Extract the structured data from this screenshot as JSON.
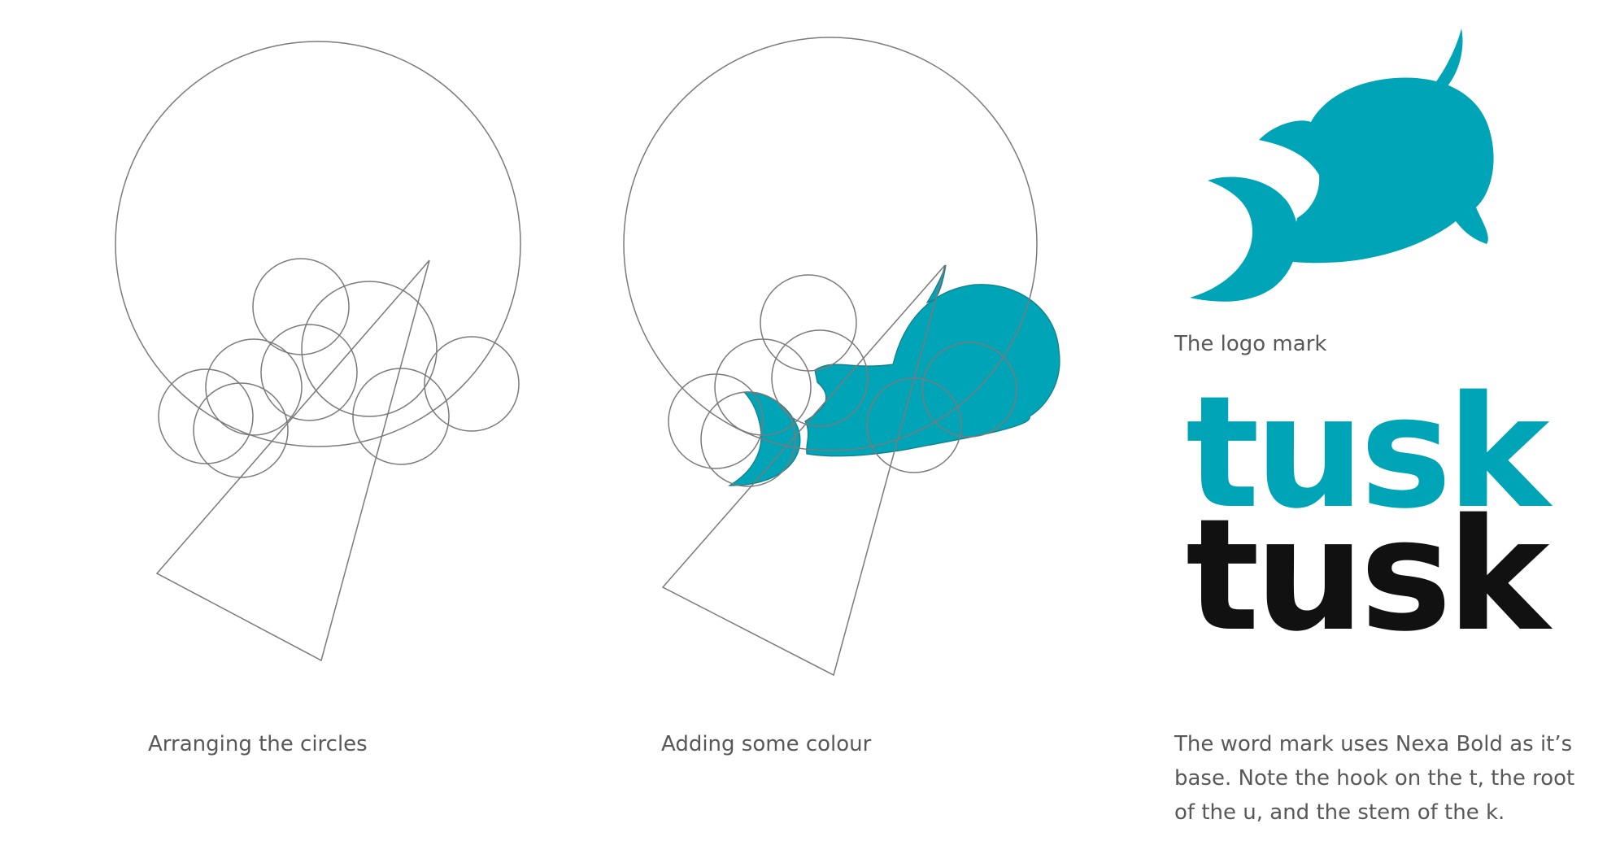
{
  "captions": {
    "construction": "Arranging the circles",
    "colour": "Adding some colour",
    "logo_mark": "The logo mark",
    "word_mark": "The word mark uses Nexa Bold as it’s base. Note the hook on the t, the root of the u, and the stem of the k."
  },
  "wordmark": {
    "colour_text": "tusk",
    "black_text": "tusk"
  },
  "colors": {
    "brand_teal": "#00a4b7",
    "construction_line": "#7a7a7a",
    "wordmark_black": "#111111",
    "caption_text": "#585858"
  },
  "icons": {
    "logo_mark": "narwhal-logo-icon"
  }
}
